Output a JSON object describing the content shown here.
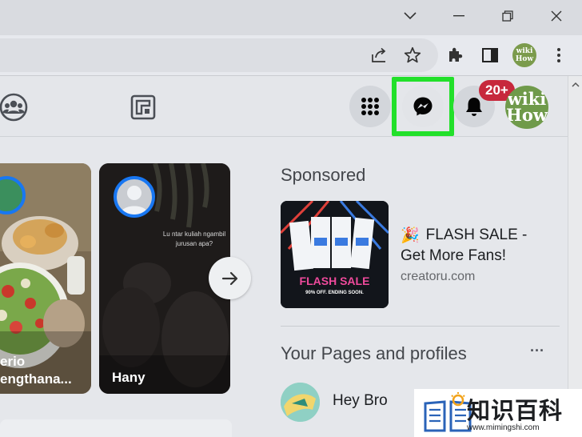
{
  "browser": {
    "profile_label": "wiki How",
    "icons": [
      "chevron-down-icon",
      "minimize-icon",
      "restore-icon",
      "close-icon",
      "share-icon",
      "star-icon",
      "extensions-icon",
      "side-panel-icon",
      "menu-icon"
    ]
  },
  "facebook_header": {
    "icons": [
      "groups-icon",
      "gaming-icon",
      "apps-menu-icon",
      "messenger-icon",
      "notifications-bell-icon"
    ],
    "notification_badge": "20+",
    "avatar_line1": "wiki",
    "avatar_line2": "How",
    "highlight_color": "#22e02a"
  },
  "stories": {
    "items": [
      {
        "name_line1": "erio",
        "name_line2": "engthana..."
      },
      {
        "name": "Hany",
        "caption_line1": "Lu ntar kuliah ngambil",
        "caption_line2": "jurusan apa?"
      }
    ]
  },
  "sponsored": {
    "title": "Sponsored",
    "ad": {
      "thumb_text": "FLASH SALE",
      "thumb_subtext": "90% OFF. ENDING SOON.",
      "emoji": "🎉",
      "title_line1": "FLASH SALE -",
      "title_line2": "Get More Fans!",
      "domain": "creatoru.com"
    }
  },
  "pages": {
    "title": "Your Pages and profiles",
    "more": "···",
    "items": [
      {
        "name": "Hey Bro"
      }
    ]
  },
  "watermark": {
    "text": "知识百科",
    "url": "www.mimingshi.com"
  }
}
